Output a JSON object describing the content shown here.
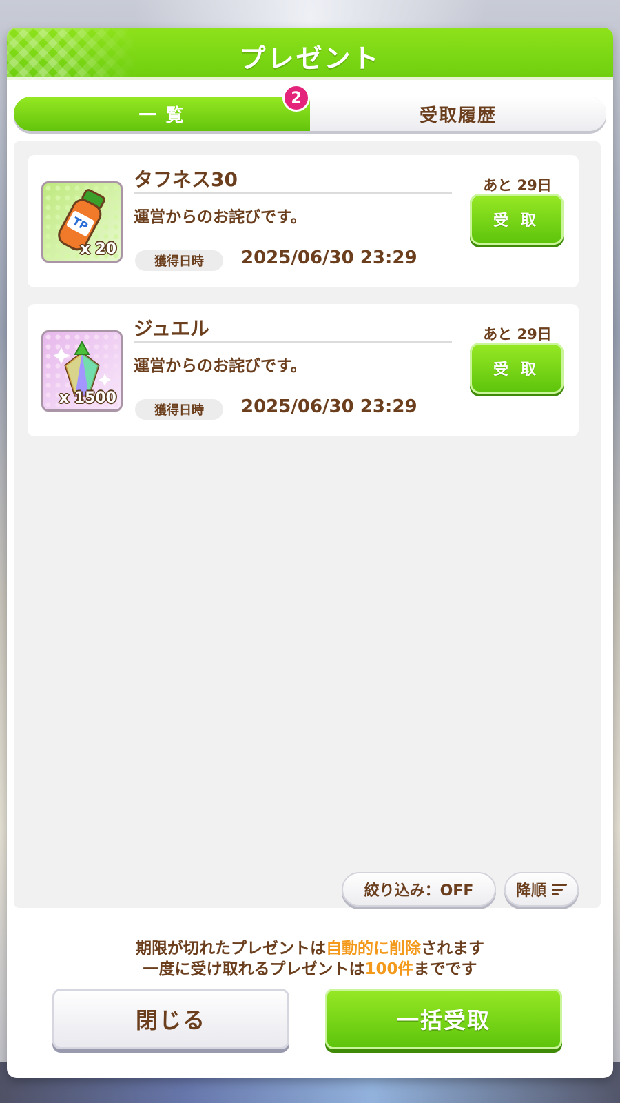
{
  "header": {
    "title": "プレゼント"
  },
  "tabs": {
    "list_label": "一 覧",
    "history_label": "受取履歴",
    "badge_count": "2"
  },
  "items": [
    {
      "title": "タフネス30",
      "description": "運営からのお詫びです。",
      "date_label": "獲得日時",
      "date": "2025/06/30 23:29",
      "remaining": "あと 29日",
      "button_label": "受 取",
      "quantity": "x 20",
      "icon": "tp-bottle-icon"
    },
    {
      "title": "ジュエル",
      "description": "運営からのお詫びです。",
      "date_label": "獲得日時",
      "date": "2025/06/30 23:29",
      "remaining": "あと 29日",
      "button_label": "受 取",
      "quantity": "x 1500",
      "icon": "jewel-icon"
    }
  ],
  "filter": {
    "label": "絞り込み：OFF"
  },
  "sort": {
    "label": "降順",
    "icon": "sort-lines-icon"
  },
  "notice": {
    "line1_pre": "期限が切れたプレゼントは",
    "line1_highlight": "自動的に削除",
    "line1_post": "されます",
    "line2_pre": "一度に受け取れるプレゼントは",
    "line2_highlight": "100件",
    "line2_post": "までです"
  },
  "buttons": {
    "close": "閉じる",
    "receive_all": "一括受取"
  },
  "colors": {
    "accent_green": "#6fcf0f",
    "text_brown": "#6b3f1d",
    "highlight_orange": "#f39a1c",
    "badge_pink": "#e3247a"
  }
}
